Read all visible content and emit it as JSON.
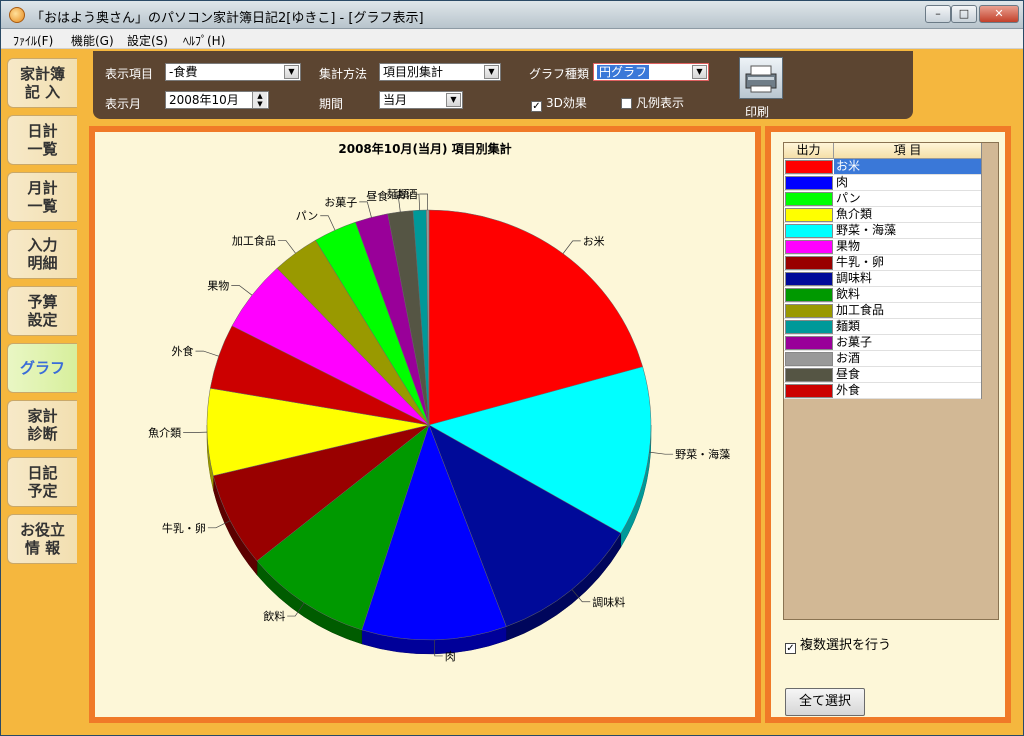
{
  "window": {
    "title": "「おはよう奥さん」のパソコン家計簿日記2[ゆきこ] - [グラフ表示]",
    "minimize": "–",
    "maximize": "□",
    "close": "✕"
  },
  "menu": [
    "ﾌｧｲﾙ(F)",
    "機能(G)",
    "設定(S)",
    "ﾍﾙﾌﾟ(H)"
  ],
  "nav": [
    {
      "lines": [
        "家計簿",
        "記 入"
      ]
    },
    {
      "lines": [
        "日計",
        "一覧"
      ]
    },
    {
      "lines": [
        "月計",
        "一覧"
      ]
    },
    {
      "lines": [
        "入力",
        "明細"
      ]
    },
    {
      "lines": [
        "予算",
        "設定"
      ]
    },
    {
      "lines": [
        "グラフ"
      ],
      "active": true
    },
    {
      "lines": [
        "家計",
        "診断"
      ]
    },
    {
      "lines": [
        "日記",
        "予定"
      ]
    },
    {
      "lines": [
        "お役立",
        "情 報"
      ]
    }
  ],
  "toolbar": {
    "display_item_label": "表示項目",
    "display_item_value": "-食費",
    "aggregation_label": "集計方法",
    "aggregation_value": "項目別集計",
    "graph_type_label": "グラフ種類",
    "graph_type_value": "円グラフ",
    "display_month_label": "表示月",
    "display_month_value": "2008年10月",
    "period_label": "期間",
    "period_value": "当月",
    "effect_3d_label": "3D効果",
    "effect_3d_checked": true,
    "legend_label": "凡例表示",
    "legend_checked": false,
    "print_label": "印刷"
  },
  "chart_data": {
    "type": "pie",
    "title": "2008年10月(当月) 項目別集計",
    "three_d": true,
    "slices": [
      {
        "label": "お米",
        "value": 21.5,
        "color": "#ff0000"
      },
      {
        "label": "野菜・海藻",
        "value": 13.3,
        "color": "#00ffff"
      },
      {
        "label": "調味料",
        "value": 11.4,
        "color": "#000a99"
      },
      {
        "label": "肉",
        "value": 11.0,
        "color": "#0000ff"
      },
      {
        "label": "飲料",
        "value": 9.6,
        "color": "#009900"
      },
      {
        "label": "牛乳・卵",
        "value": 7.4,
        "color": "#990000"
      },
      {
        "label": "魚介類",
        "value": 6.8,
        "color": "#ffff00"
      },
      {
        "label": "外食",
        "value": 5.1,
        "color": "#cc0000"
      },
      {
        "label": "果物",
        "value": 5.6,
        "color": "#ff00ff"
      },
      {
        "label": "加工食品",
        "value": 3.6,
        "color": "#999900"
      },
      {
        "label": "パン",
        "value": 3.3,
        "color": "#00ff00"
      },
      {
        "label": "お菓子",
        "value": 2.5,
        "color": "#990099"
      },
      {
        "label": "昼食",
        "value": 1.9,
        "color": "#555544"
      },
      {
        "label": "麺類",
        "value": 1.0,
        "color": "#009999"
      },
      {
        "label": "お酒",
        "value": 0.2,
        "color": "#999999"
      }
    ]
  },
  "item_list": {
    "header_output": "出力",
    "header_item": "項 目",
    "items": [
      {
        "label": "お米",
        "color": "#ff0000",
        "selected": true
      },
      {
        "label": "肉",
        "color": "#0000ff"
      },
      {
        "label": "パン",
        "color": "#00ff00"
      },
      {
        "label": "魚介類",
        "color": "#ffff00"
      },
      {
        "label": "野菜・海藻",
        "color": "#00ffff"
      },
      {
        "label": "果物",
        "color": "#ff00ff"
      },
      {
        "label": "牛乳・卵",
        "color": "#990000"
      },
      {
        "label": "調味料",
        "color": "#000a99"
      },
      {
        "label": "飲料",
        "color": "#009900"
      },
      {
        "label": "加工食品",
        "color": "#999900"
      },
      {
        "label": "麺類",
        "color": "#009999"
      },
      {
        "label": "お菓子",
        "color": "#990099"
      },
      {
        "label": "お酒",
        "color": "#999999"
      },
      {
        "label": "昼食",
        "color": "#555544"
      },
      {
        "label": "外食",
        "color": "#cc0000"
      }
    ],
    "multi_select_label": "複数選択を行う",
    "multi_select_checked": true,
    "select_all_label": "全て選択"
  }
}
